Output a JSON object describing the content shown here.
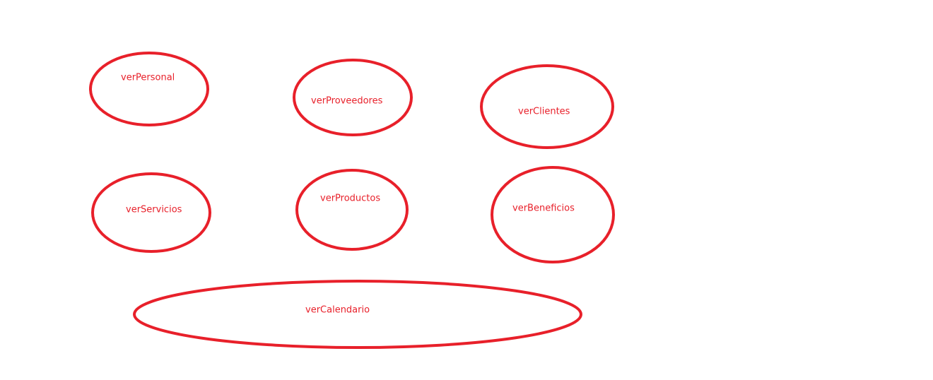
{
  "colors": {
    "stroke": "#e8202a",
    "text": "#e8202a",
    "background": "#ffffff"
  },
  "nodes": [
    {
      "id": "verPersonal",
      "label": "verPersonal"
    },
    {
      "id": "verProveedores",
      "label": "verProveedores"
    },
    {
      "id": "verClientes",
      "label": "verClientes"
    },
    {
      "id": "verServicios",
      "label": "verServicios"
    },
    {
      "id": "verProductos",
      "label": "verProductos"
    },
    {
      "id": "verBeneficios",
      "label": "verBeneficios"
    },
    {
      "id": "verCalendario",
      "label": "verCalendario"
    }
  ]
}
